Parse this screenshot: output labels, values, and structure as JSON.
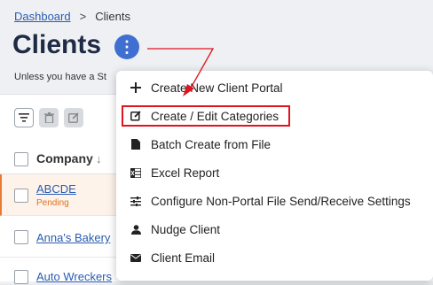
{
  "breadcrumb": {
    "root": "Dashboard",
    "current": "Clients"
  },
  "page": {
    "title": "Clients",
    "subtitle": "Unless you have a St"
  },
  "toolbar": {
    "icons": [
      "filter-icon",
      "trash-icon",
      "edit-icon"
    ]
  },
  "table": {
    "column_company": "Company",
    "rows": [
      {
        "name": "ABCDE",
        "status": "Pending"
      },
      {
        "name": "Anna's Bakery",
        "status": ""
      },
      {
        "name": "Auto Wreckers",
        "status": ""
      }
    ]
  },
  "menu": {
    "items": [
      {
        "label": "Create New Client Portal",
        "icon": "plus-icon"
      },
      {
        "label": "Create / Edit Categories",
        "icon": "edit-square-icon"
      },
      {
        "label": "Batch Create from File",
        "icon": "file-icon"
      },
      {
        "label": "Excel Report",
        "icon": "excel-icon"
      },
      {
        "label": "Configure Non-Portal File Send/Receive Settings",
        "icon": "sliders-icon"
      },
      {
        "label": "Nudge Client",
        "icon": "person-icon"
      },
      {
        "label": "Client Email",
        "icon": "mail-icon"
      }
    ]
  },
  "colors": {
    "accent": "#3f6fd0",
    "annotation": "#e0141e",
    "pending": "#e07020"
  }
}
